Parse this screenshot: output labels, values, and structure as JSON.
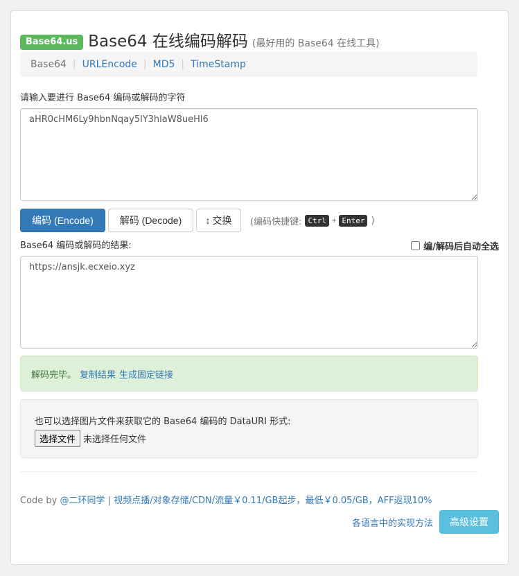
{
  "header": {
    "badge": "Base64.us",
    "title": "Base64 在线编码解码",
    "subtitle": "(最好用的 Base64 在线工具)"
  },
  "nav": {
    "items": [
      {
        "label": "Base64",
        "active": true
      },
      {
        "label": "URLEncode",
        "active": false
      },
      {
        "label": "MD5",
        "active": false
      },
      {
        "label": "TimeStamp",
        "active": false
      }
    ],
    "separator": "|"
  },
  "input": {
    "label": "请输入要进行 Base64 编码或解码的字符",
    "value": "aHR0cHM6Ly9hbnNqay5lY3hlaW8ueHl6"
  },
  "buttons": {
    "encode": "编码 (Encode)",
    "decode": "解码 (Decode)",
    "swap_icon": "↕",
    "swap": "交换",
    "hint_prefix": "(编码快捷键:",
    "key1": "Ctrl",
    "plus": "+",
    "key2": "Enter",
    "hint_suffix": ")"
  },
  "output": {
    "label": "Base64 编码或解码的结果:",
    "autoselect_label": "编/解码后自动全选",
    "autoselect_checked": false,
    "value": "https://ansjk.ecxeio.xyz"
  },
  "alert": {
    "status": "解码完毕。",
    "copy_link": "复制结果",
    "permalink": "生成固定链接"
  },
  "file": {
    "description": "也可以选择图片文件来获取它的 Base64 编码的 DataURI 形式:",
    "button": "选择文件",
    "status": "未选择任何文件"
  },
  "footer": {
    "code_by": "Code by",
    "author": "@二环同学",
    "sep": "|",
    "promo": "视频点播/对象存储/CDN/流量￥0.11/GB起步，最低￥0.05/GB，AFF返现10%",
    "impl_link": "各语言中的实现方法",
    "advanced": "高级设置"
  }
}
